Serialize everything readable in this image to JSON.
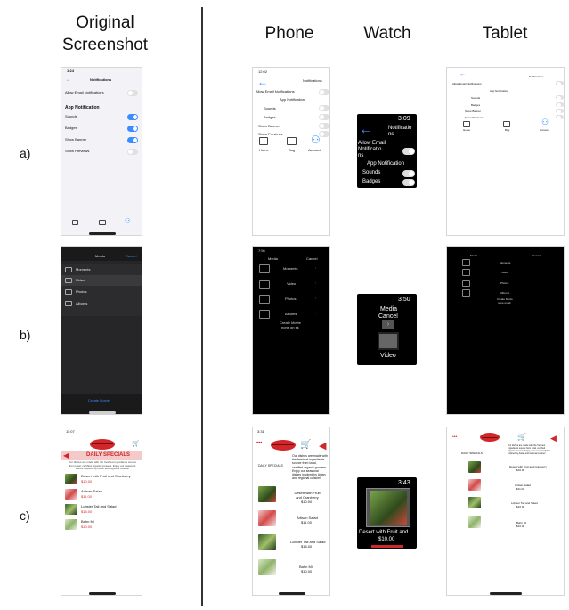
{
  "headers": {
    "original": "Original\nScreenshot",
    "phone": "Phone",
    "watch": "Watch",
    "tablet": "Tablet"
  },
  "rows": {
    "a": "a)",
    "b": "b)",
    "c": "c)"
  },
  "notif": {
    "time": "1:24",
    "title": "Notifications",
    "allow_email": "Allow Email Notifications",
    "section": "App Notification",
    "sounds": "Sounds",
    "badges": "Badges",
    "show_banner": "Show Banner",
    "show_preview": "Show Previews",
    "tab_home": "Home",
    "tab_bag": "Bag",
    "tab_account": "Account",
    "phone_time": "12:02",
    "watch_time": "3:09",
    "watch_title": "Notificatio\nns",
    "watch_allow": "Allow Email\nNotificatio\nns",
    "watch_section": "App Notification",
    "watch_sounds": "Sounds",
    "watch_badges": "Badges"
  },
  "media": {
    "title": "Media",
    "cancel": "Cancel",
    "items": [
      "Moments",
      "Video",
      "Photos",
      "Albums"
    ],
    "create": "Create Movie",
    "create_sub": "none on sk",
    "phone_time": "7:56",
    "watch_time": "3:50",
    "watch_media": "Media",
    "watch_cancel": "Cancel",
    "watch_video": "Video"
  },
  "food": {
    "time": "11:07",
    "banner": "DAILY SPECIALS",
    "desc": "Our dishes are made with the freshest ingredients source from local, certified organic growers. Enjoy our seasonal dishes inspired by Asian and regional cuisine!",
    "items": [
      {
        "name": "Desert with Fruit and Cranberry",
        "price": "$10.00"
      },
      {
        "name": "Artisan Salad",
        "price": "$11.00"
      },
      {
        "name": "Lobster Tail and Salad",
        "price": "$16.00"
      },
      {
        "name": "Bahn Mi",
        "price": "$10.00"
      }
    ],
    "phone_time": "3:31",
    "phone_banner": "DAILY SPECIALS",
    "phone_desc": "Our dishes are made with the freshest ingredients source from local, certified organic growers. Enjoy our seasonal dishes inspired by Asian and regional cuisine!",
    "phone_items": [
      {
        "name": "Desert with Fruit and Cranberry",
        "price": "$10.00"
      },
      {
        "name": "Artisan Salad",
        "price": "$11.00"
      },
      {
        "name": "Lobster Tail and Salad",
        "price": "$16.00"
      },
      {
        "name": "Bahn Mi",
        "price": "$10.00"
      }
    ],
    "watch_time": "3:43",
    "watch_name": "Desert with Fruit and...",
    "watch_price": "$10.00",
    "tablet_banner": "DAILY SPECIALS",
    "tablet_items": [
      {
        "name": "Artisan Salad",
        "price": "$11.00"
      },
      {
        "name": "Lobster Tail and Salad",
        "price": "$16.00"
      },
      {
        "name": "Bahn Mi",
        "price": "$10.00"
      }
    ],
    "tablet_first": "Desert with Fruit and Cranberry",
    "tablet_first_price": "$10.00"
  },
  "colors": {
    "accent_blue": "#3b8cff",
    "brand_red": "#d0272a",
    "divider": "#333333"
  }
}
